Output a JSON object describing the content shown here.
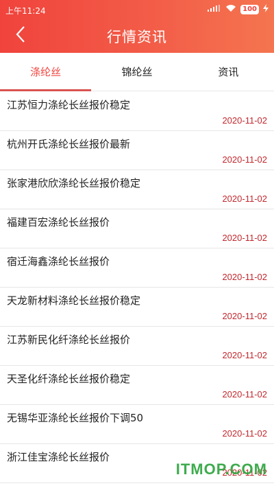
{
  "status_bar": {
    "time": "上午11:24",
    "signal_text": "...|",
    "battery": "100"
  },
  "header": {
    "title": "行情资讯",
    "back_icon": "chevron-left-icon"
  },
  "tabs": [
    {
      "label": "涤纶丝",
      "active": true
    },
    {
      "label": "锦纶丝",
      "active": false
    },
    {
      "label": "资讯",
      "active": false
    }
  ],
  "news": [
    {
      "title": "江苏恒力涤纶长丝报价稳定",
      "date": "2020-11-02"
    },
    {
      "title": "杭州开氏涤纶长丝报价最新",
      "date": "2020-11-02"
    },
    {
      "title": "张家港欣欣涤纶长丝报价稳定",
      "date": "2020-11-02"
    },
    {
      "title": "福建百宏涤纶长丝报价",
      "date": "2020-11-02"
    },
    {
      "title": "宿迁海鑫涤纶长丝报价",
      "date": "2020-11-02"
    },
    {
      "title": "天龙新材料涤纶长丝报价稳定",
      "date": "2020-11-02"
    },
    {
      "title": "江苏新民化纤涤纶长丝报价",
      "date": "2020-11-02"
    },
    {
      "title": "天圣化纤涤纶长丝报价稳定",
      "date": "2020-11-02"
    },
    {
      "title": "无锡华亚涤纶长丝报价下调50",
      "date": "2020-11-02"
    },
    {
      "title": "浙江佳宝涤纶长丝报价",
      "date": "2020-11-02"
    }
  ],
  "watermark": "ITMOP.COM",
  "colors": {
    "header": "#f0433c",
    "accent": "#c1272d"
  }
}
